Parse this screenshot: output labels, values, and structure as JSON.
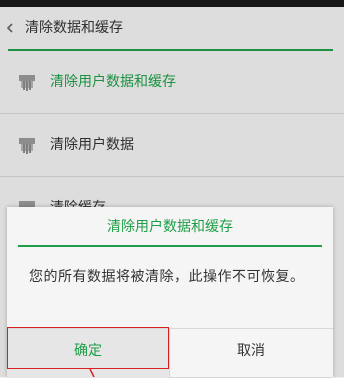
{
  "header": {
    "title": "清除数据和缓存"
  },
  "list": {
    "items": [
      {
        "label": "清除用户数据和缓存",
        "icon": "clean-icon",
        "active": true
      },
      {
        "label": "清除用户数据",
        "icon": "clean-icon",
        "active": false
      },
      {
        "label": "清除缓存",
        "icon": "clean-icon",
        "active": false
      }
    ]
  },
  "dialog": {
    "title": "清除用户数据和缓存",
    "message": "您的所有数据将被清除，此操作不可恢复。",
    "confirm_label": "确定",
    "cancel_label": "取消"
  },
  "colors": {
    "accent": "#1e9e47",
    "highlight": "#d82020"
  }
}
